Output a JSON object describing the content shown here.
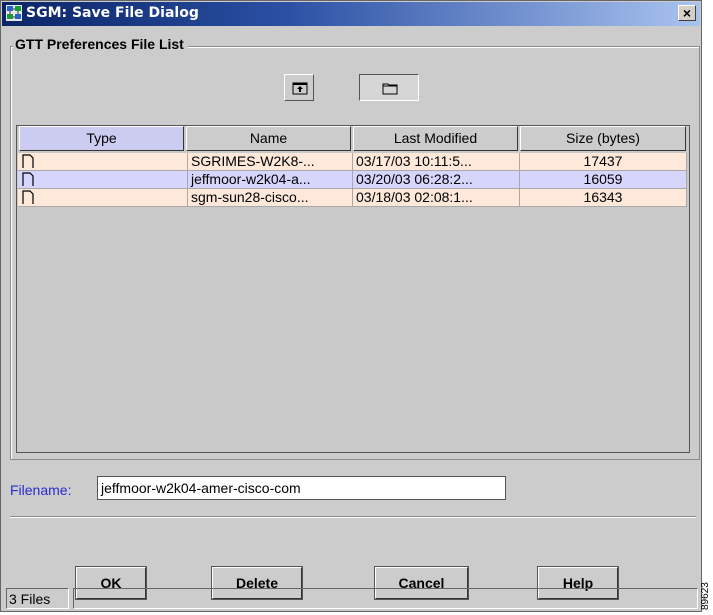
{
  "window": {
    "title": "SGM: Save File Dialog",
    "close_label": "×"
  },
  "group": {
    "legend": "GTT Preferences File List"
  },
  "table": {
    "columns": [
      "Type",
      "Name",
      "Last Modified",
      "Size (bytes)"
    ],
    "sorted_column": "Type",
    "rows": [
      {
        "type": "file-icon",
        "name": "SGRIMES-W2K8-...",
        "modified": "03/17/03  10:11:5...",
        "size": "17437"
      },
      {
        "type": "file-icon",
        "name": "jeffmoor-w2k04-a...",
        "modified": "03/20/03  06:28:2...",
        "size": "16059"
      },
      {
        "type": "file-icon",
        "name": "sgm-sun28-cisco...",
        "modified": "03/18/03  02:08:1...",
        "size": "16343"
      }
    ]
  },
  "filename": {
    "label": "Filename:",
    "value": "jeffmoor-w2k04-amer-cisco-com"
  },
  "buttons": {
    "ok": "OK",
    "delete": "Delete",
    "cancel": "Cancel",
    "help": "Help"
  },
  "status": {
    "count": "3 Files"
  },
  "figure_id": "89623",
  "colors": {
    "row_odd": "#fde8da",
    "row_even": "#d6d6fc",
    "sorted_header": "#ccccf0",
    "title_bar_start": "#0b2466",
    "label_blue": "#2a2ad0"
  }
}
